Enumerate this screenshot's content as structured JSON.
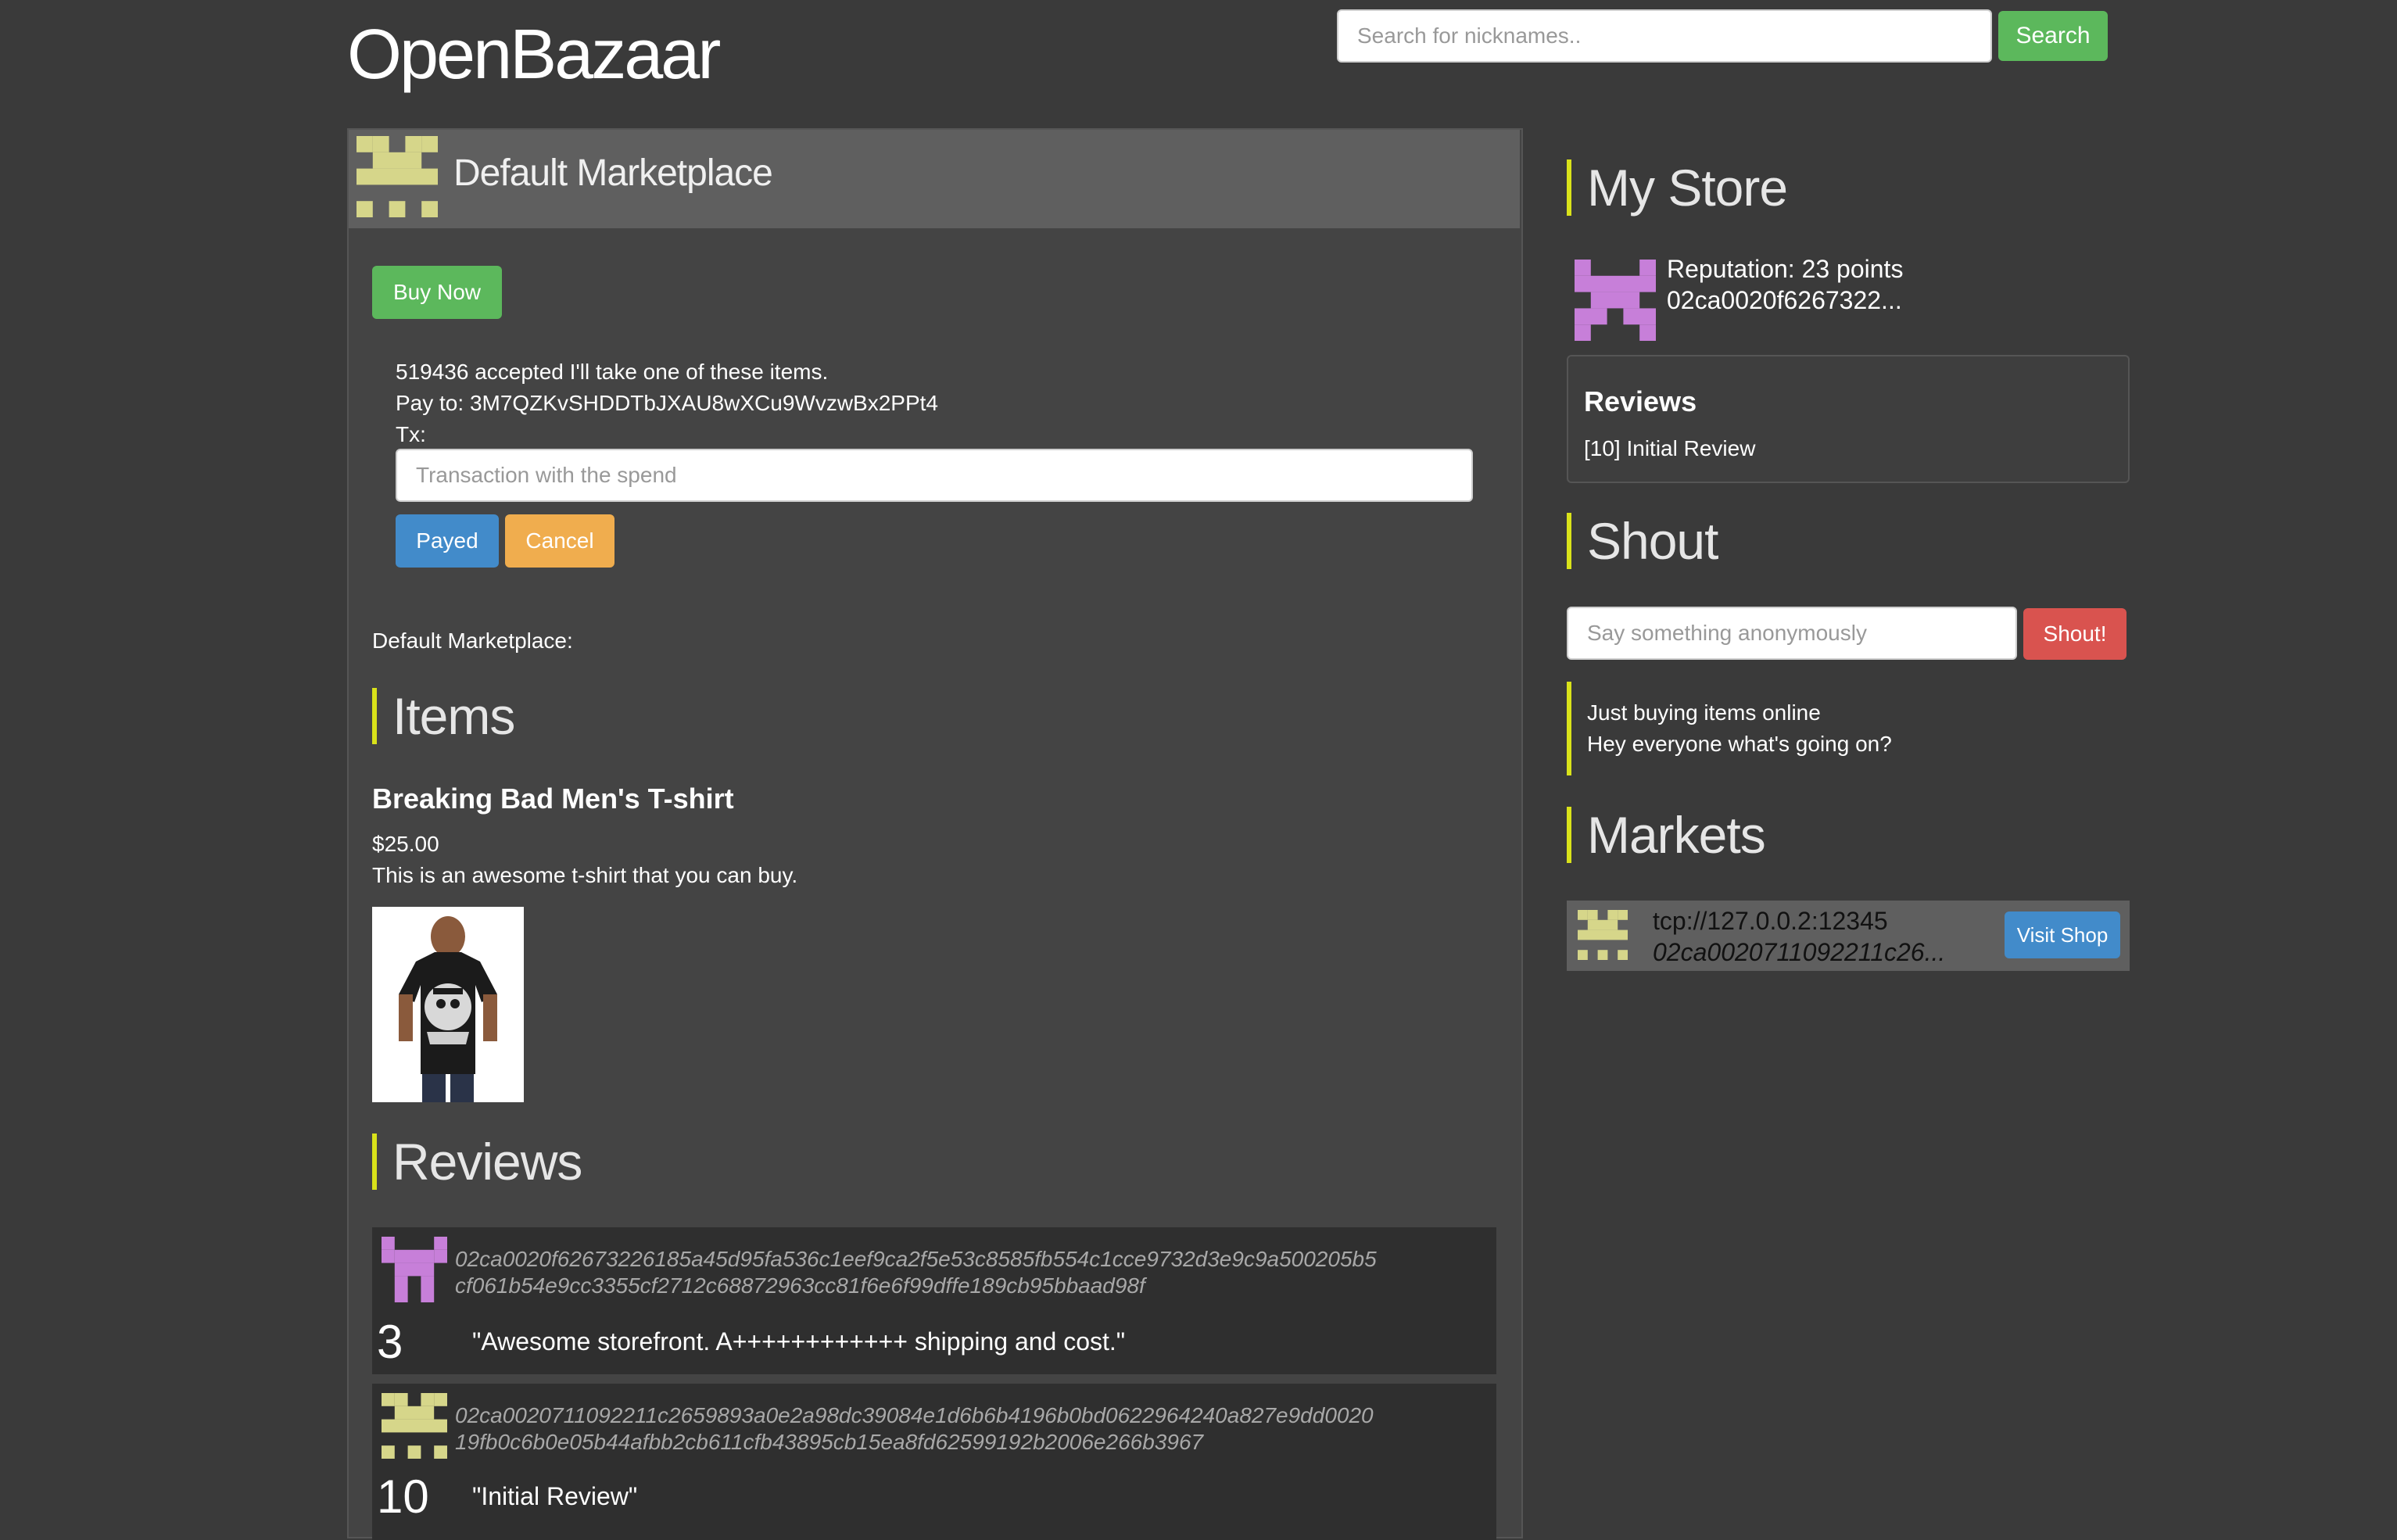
{
  "header": {
    "logo": "OpenBazaar",
    "search_placeholder": "Search for nicknames..",
    "search_button": "Search"
  },
  "market": {
    "title": "Default Marketplace",
    "buy_button": "Buy Now",
    "order_message": "519436 accepted I'll take one of these items.",
    "pay_to": "Pay to: 3M7QZKvSHDDTbJXAU8wXCu9WvzwBx2PPt4",
    "tx_label": "Tx:",
    "tx_placeholder": "Transaction with the spend",
    "payed_button": "Payed",
    "cancel_button": "Cancel",
    "marketplace_label": "Default Marketplace:",
    "items_heading": "Items",
    "item": {
      "name": "Breaking Bad Men's T-shirt",
      "price": "$25.00",
      "description": "This is an awesome t-shirt that you can buy."
    },
    "reviews_heading": "Reviews",
    "reviews": [
      {
        "hash_line1": "02ca0020f62673226185a45d95fa536c1eef9ca2f5e53c8585fb554c1cce9732d3e9c9a500205b5",
        "hash_line2": "cf061b54e9cc3355cf2712c68872963cc81f6e6f99dffe189cb95bbaad98f",
        "rating": "3",
        "text": "\"Awesome storefront. A++++++++++++ shipping and cost.\"",
        "icon_color": "#c77fd9"
      },
      {
        "hash_line1": "02ca0020711092211c2659893a0e2a98dc39084e1d6b6b4196b0bd0622964240a827e9dd0020",
        "hash_line2": "19fb0c6b0e05b44afbb2cb611cfb43895cb15ea8fd62599192b2006e266b3967",
        "rating": "10",
        "text": "\"Initial Review\"",
        "icon_color": "#d6d68a"
      }
    ]
  },
  "sidebar": {
    "my_store_heading": "My Store",
    "reputation": "Reputation: 23 points",
    "store_id": "02ca0020f6267322...",
    "reviews_title": "Reviews",
    "reviews_entry": "[10] Initial Review",
    "shout_heading": "Shout",
    "shout_placeholder": "Say something anonymously",
    "shout_button": "Shout!",
    "shouts": [
      "Just buying items online",
      "Hey everyone what's going on?"
    ],
    "markets_heading": "Markets",
    "market_entry": {
      "address": "tcp://127.0.0.2:12345",
      "id": "02ca0020711092211c26...",
      "visit_button": "Visit Shop"
    }
  },
  "colors": {
    "accent_bar": "#d9e21a",
    "success": "#5cb85c",
    "primary": "#428bca",
    "warning": "#f0ad4e",
    "danger": "#d9534f",
    "identicon_yellow": "#d6d68a",
    "identicon_purple": "#c77fd9"
  }
}
